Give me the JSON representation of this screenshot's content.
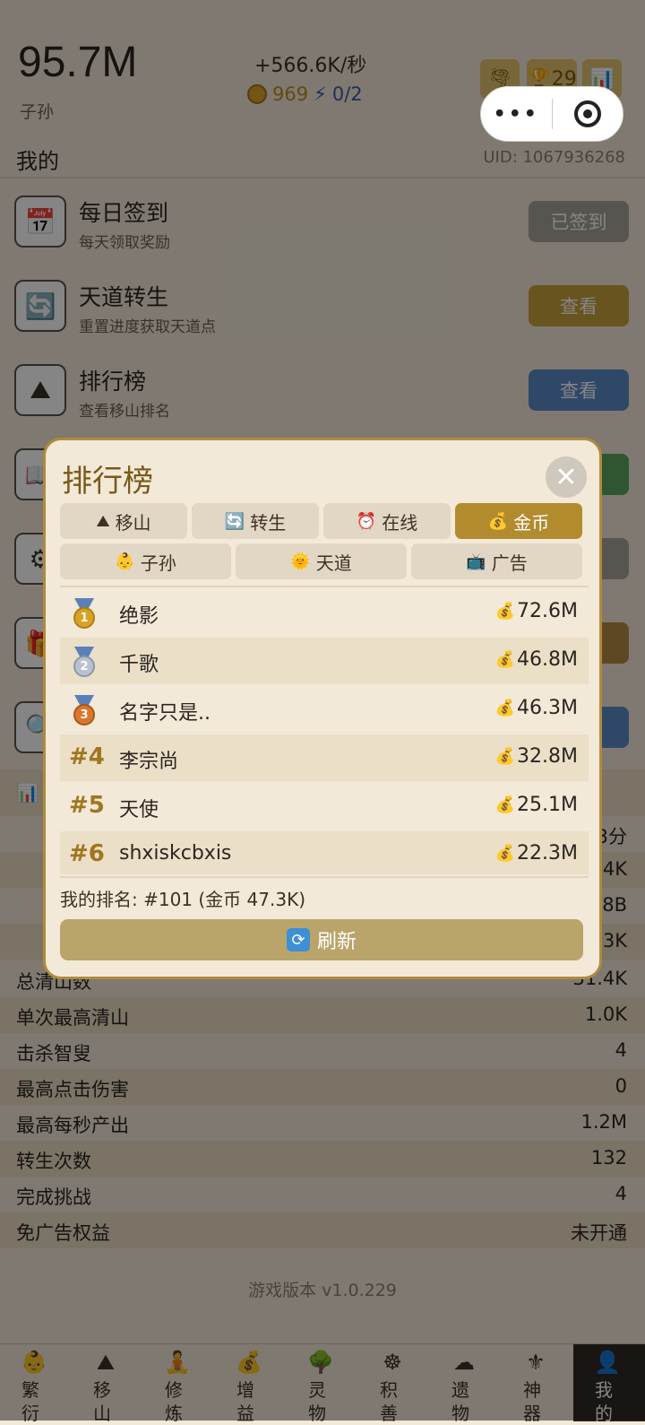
{
  "header": {
    "total": "95.7M",
    "total_label": "子孙",
    "rate": "+566.6K/秒",
    "coins": "969",
    "energy": "0/2",
    "trophy_count": "29"
  },
  "section": {
    "title": "我的",
    "uid": "UID: 1067936268"
  },
  "rows": [
    {
      "title": "每日签到",
      "desc": "每天领取奖励",
      "button": "已签到",
      "icon": "calendar-icon"
    },
    {
      "title": "天道转生",
      "desc": "重置进度获取天道点",
      "button": "查看",
      "icon": "rebirth-icon"
    },
    {
      "title": "排行榜",
      "desc": "查看移山排名",
      "button": "查看",
      "icon": "mountain-icon"
    }
  ],
  "stats": [
    {
      "label": "总清山数",
      "value": "31.4K"
    },
    {
      "label": "单次最高清山",
      "value": "1.0K"
    },
    {
      "label": "击杀智叟",
      "value": "4"
    },
    {
      "label": "最高点击伤害",
      "value": "0"
    },
    {
      "label": "最高每秒产出",
      "value": "1.2M"
    },
    {
      "label": "转生次数",
      "value": "132"
    },
    {
      "label": "完成挑战",
      "value": "4"
    },
    {
      "label": "免广告权益",
      "value": "未开通"
    }
  ],
  "version": "游戏版本 v1.0.229",
  "nav": [
    {
      "label": "繁衍",
      "icon": "baby-icon"
    },
    {
      "label": "移山",
      "icon": "mountain-icon"
    },
    {
      "label": "修炼",
      "icon": "cultivate-icon"
    },
    {
      "label": "增益",
      "icon": "moneybag-icon"
    },
    {
      "label": "灵物",
      "icon": "tree-icon"
    },
    {
      "label": "积善",
      "icon": "dharma-wheel-icon"
    },
    {
      "label": "遗物",
      "icon": "cloud-icon"
    },
    {
      "label": "神器",
      "icon": "fleur-icon"
    },
    {
      "label": "我的",
      "icon": "user-icon"
    }
  ],
  "modal": {
    "title": "排行榜",
    "close": "✕",
    "tabs_row1": [
      {
        "label": "移山",
        "icon": "mountain-icon"
      },
      {
        "label": "转生",
        "icon": "rebirth-icon"
      },
      {
        "label": "在线",
        "icon": "clock-icon"
      },
      {
        "label": "金币",
        "icon": "moneybag-icon"
      }
    ],
    "tabs_row2": [
      {
        "label": "子孙",
        "icon": "baby-icon"
      },
      {
        "label": "天道",
        "icon": "sun-icon"
      },
      {
        "label": "广告",
        "icon": "tv-icon"
      }
    ],
    "active_tab": "金币",
    "leaders": [
      {
        "rank": "1",
        "name": "绝影",
        "value": "72.6M"
      },
      {
        "rank": "2",
        "name": "千歌",
        "value": "46.8M"
      },
      {
        "rank": "3",
        "name": "名字只是..",
        "value": "46.3M"
      },
      {
        "rank": "#4",
        "name": "李宗尚",
        "value": "32.8M"
      },
      {
        "rank": "#5",
        "name": "天使",
        "value": "25.1M"
      },
      {
        "rank": "#6",
        "name": "shxiskcbxis",
        "value": "22.3M"
      }
    ],
    "my_rank": "我的排名: #101 (金币 47.3K)",
    "refresh": "刷新"
  }
}
